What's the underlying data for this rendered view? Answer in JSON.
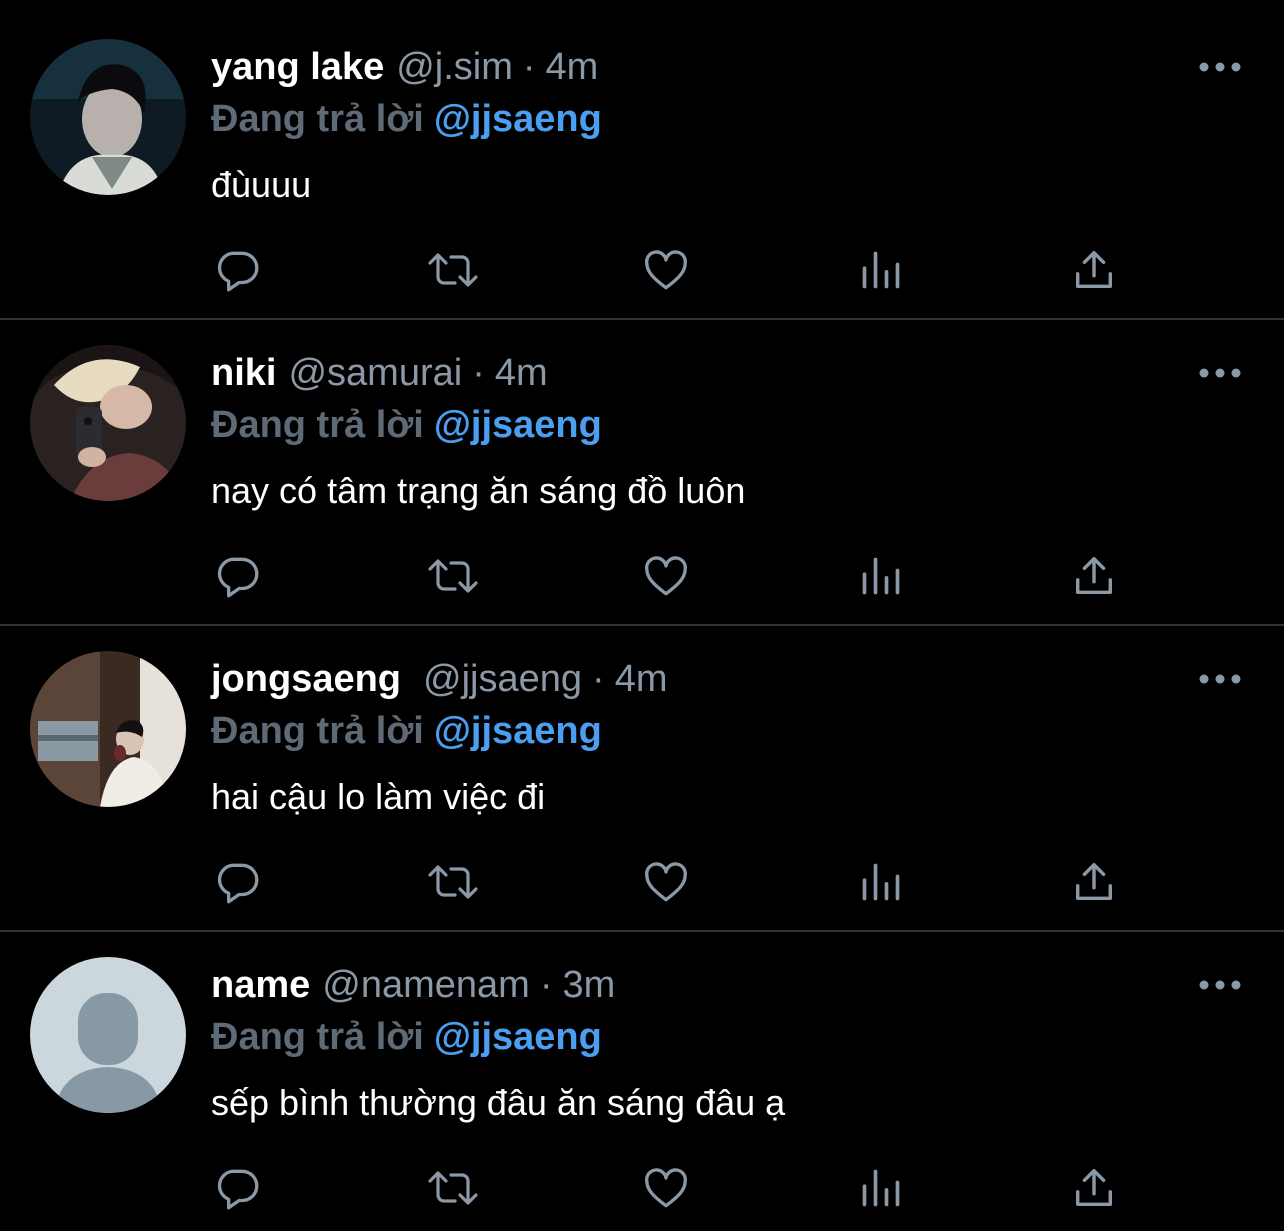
{
  "colors": {
    "background": "#000000",
    "divider": "#2f3336",
    "secondary_text": "#8b98a5",
    "reply_prefix": "#5e6b77",
    "mention": "#4b9ff0",
    "icon": "#8b98a5"
  },
  "tweets": [
    {
      "display_name": "yang lake",
      "handle": "@j.sim",
      "separator": "·",
      "time": "4m",
      "reply_prefix": "Đang trả lời",
      "reply_to": "@jjsaeng",
      "text": "đùuuu",
      "avatar": "photo-avatar"
    },
    {
      "display_name": "niki",
      "handle": "@samurai",
      "separator": "·",
      "time": "4m",
      "reply_prefix": "Đang trả lời",
      "reply_to": "@jjsaeng",
      "text": "nay có tâm trạng ăn sáng đồ luôn",
      "avatar": "photo-avatar"
    },
    {
      "display_name": "jongsaeng",
      "handle": "@jjsaeng",
      "separator": "·",
      "time": "4m",
      "reply_prefix": "Đang trả lời",
      "reply_to": "@jjsaeng",
      "text": "hai cậu lo làm việc đi",
      "avatar": "photo-avatar"
    },
    {
      "display_name": "name",
      "handle": "@namenam",
      "separator": "·",
      "time": "3m",
      "reply_prefix": "Đang trả lời",
      "reply_to": "@jjsaeng",
      "text": "sếp bình thường đâu ăn sáng đâu ạ",
      "avatar": "default-avatar"
    }
  ],
  "icons": {
    "more": "more-dots-icon",
    "reply": "reply-bubble-icon",
    "retweet": "retweet-icon",
    "like": "heart-icon",
    "stats": "analytics-icon",
    "share": "share-icon"
  }
}
